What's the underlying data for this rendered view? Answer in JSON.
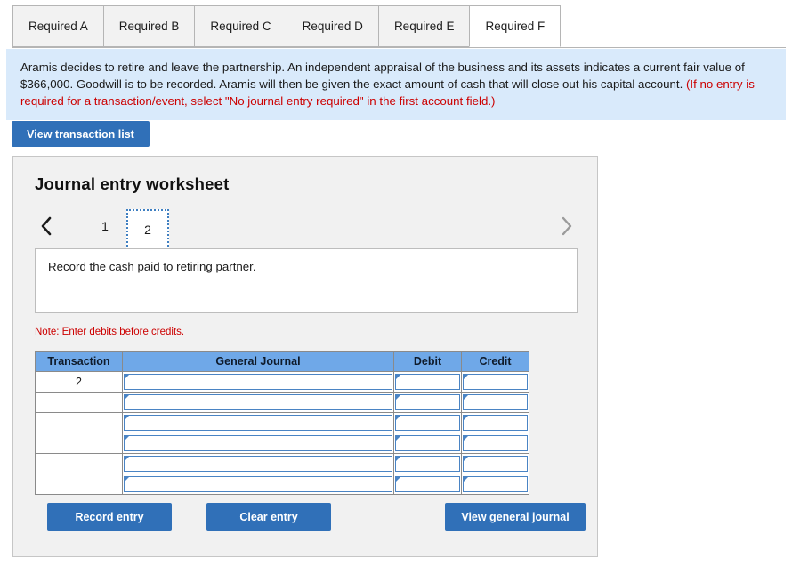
{
  "tabs": [
    {
      "label": "Required A",
      "active": false
    },
    {
      "label": "Required B",
      "active": false
    },
    {
      "label": "Required C",
      "active": false
    },
    {
      "label": "Required D",
      "active": false
    },
    {
      "label": "Required E",
      "active": false
    },
    {
      "label": "Required F",
      "active": true
    }
  ],
  "banner": {
    "body": "Aramis decides to retire and leave the partnership. An independent appraisal of the business and its assets indicates a current fair value of $366,000. Goodwill is to be recorded. Aramis will then be given the exact amount of cash that will close out his capital account. ",
    "parenthetical": "(If no entry is required for a transaction/event, select \"No journal entry required\" in the first account field.)"
  },
  "toolbar": {
    "view_transaction_list_label": "View transaction list"
  },
  "worksheet": {
    "title": "Journal entry worksheet",
    "pager": {
      "prev_icon": "chevron-left-icon",
      "next_icon": "chevron-right-icon",
      "pages": [
        "1",
        "2"
      ],
      "selected_page": "2"
    },
    "prompt": "Record the cash paid to retiring partner.",
    "note": "Note: Enter debits before credits.",
    "table": {
      "headers": [
        "Transaction",
        "General Journal",
        "Debit",
        "Credit"
      ],
      "rows": [
        {
          "transaction": "2",
          "general_journal": "",
          "debit": "",
          "credit": ""
        },
        {
          "transaction": "",
          "general_journal": "",
          "debit": "",
          "credit": ""
        },
        {
          "transaction": "",
          "general_journal": "",
          "debit": "",
          "credit": ""
        },
        {
          "transaction": "",
          "general_journal": "",
          "debit": "",
          "credit": ""
        },
        {
          "transaction": "",
          "general_journal": "",
          "debit": "",
          "credit": ""
        },
        {
          "transaction": "",
          "general_journal": "",
          "debit": "",
          "credit": ""
        }
      ]
    },
    "buttons": {
      "record_entry": "Record entry",
      "clear_entry": "Clear entry",
      "view_general_journal": "View general journal"
    }
  },
  "colors": {
    "header_blue": "#6fa8e8",
    "button_blue": "#3070b8",
    "banner_blue": "#d9eafb",
    "note_red": "#cc0000",
    "panel_gray": "#f1f1f1",
    "selected_page_outline": "#3f7fc1"
  }
}
